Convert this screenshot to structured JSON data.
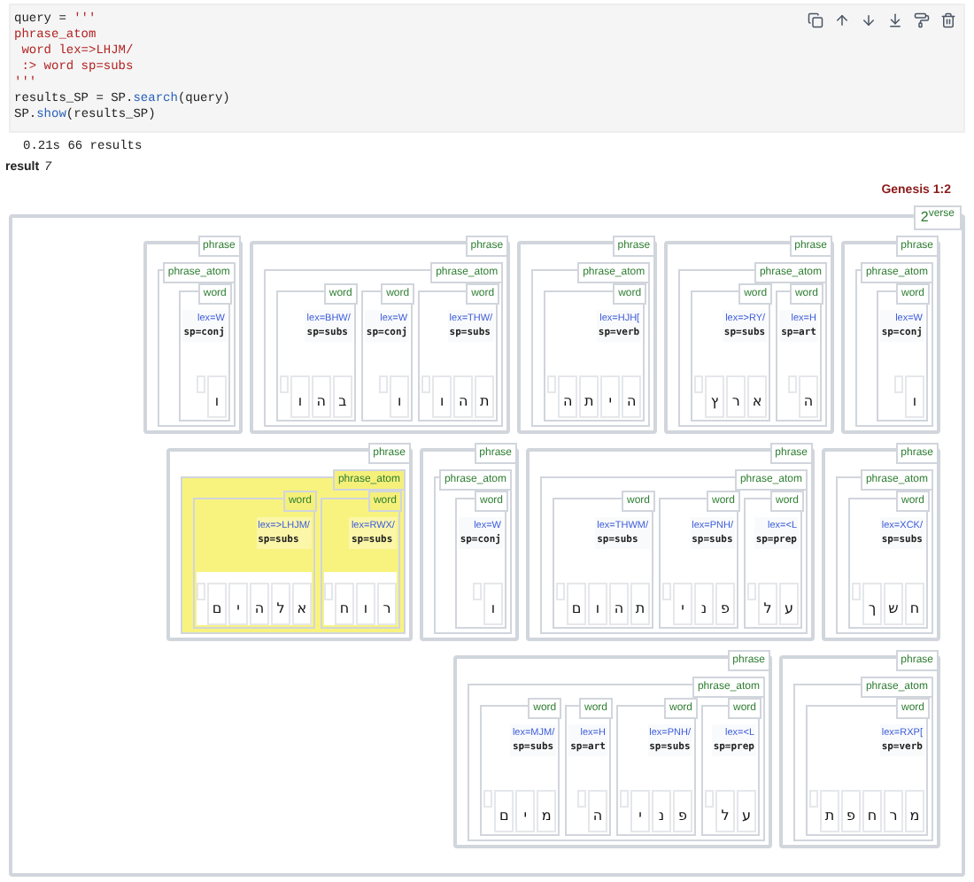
{
  "code_cell": {
    "lines": [
      [
        {
          "text": "query = ",
          "kind": "plain"
        },
        {
          "text": "'''",
          "kind": "string"
        }
      ],
      [
        {
          "text": "phrase_atom",
          "kind": "string"
        }
      ],
      [
        {
          "text": " word lex=>LHJM/",
          "kind": "string"
        }
      ],
      [
        {
          "text": " :> word sp=subs",
          "kind": "string"
        }
      ],
      [
        {
          "text": "'''",
          "kind": "string"
        }
      ],
      [
        {
          "text": "results_SP = SP.",
          "kind": "plain"
        },
        {
          "text": "search",
          "kind": "function"
        },
        {
          "text": "(query)",
          "kind": "plain"
        }
      ],
      [
        {
          "text": "SP.",
          "kind": "plain"
        },
        {
          "text": "show",
          "kind": "function"
        },
        {
          "text": "(results_SP)",
          "kind": "plain"
        }
      ]
    ]
  },
  "output": {
    "timing": "0.21s 66 results",
    "result_label": "result",
    "result_number": "7",
    "passage": "Genesis 1:2"
  },
  "verse": {
    "label": "2$^{verse}$",
    "lines": [
      {
        "phrases": [
          {
            "label": "phrase",
            "atom": {
              "label": "phrase_atom",
              "highlighted": false,
              "words": [
                {
                  "label": "word",
                  "lex": "lex=W",
                  "sp": "sp=conj",
                  "highlighted": false,
                  "letters": [
                    "ו"
                  ]
                }
              ]
            }
          },
          {
            "label": "phrase",
            "atom": {
              "label": "phrase_atom",
              "highlighted": false,
              "words": [
                {
                  "label": "word",
                  "lex": "lex=BHW/",
                  "sp": "sp=subs",
                  "highlighted": false,
                  "letters": [
                    "ב",
                    "ה",
                    "ו"
                  ]
                },
                {
                  "label": "word",
                  "lex": "lex=W",
                  "sp": "sp=conj",
                  "highlighted": false,
                  "letters": [
                    "ו"
                  ]
                },
                {
                  "label": "word",
                  "lex": "lex=THW/",
                  "sp": "sp=subs",
                  "highlighted": false,
                  "letters": [
                    "ת",
                    "ה",
                    "ו"
                  ]
                }
              ]
            }
          },
          {
            "label": "phrase",
            "atom": {
              "label": "phrase_atom",
              "highlighted": false,
              "words": [
                {
                  "label": "word",
                  "lex": "lex=HJH[",
                  "sp": "sp=verb",
                  "highlighted": false,
                  "letters": [
                    "ה",
                    "י",
                    "ת",
                    "ה"
                  ]
                }
              ]
            }
          },
          {
            "label": "phrase",
            "atom": {
              "label": "phrase_atom",
              "highlighted": false,
              "words": [
                {
                  "label": "word",
                  "lex": "lex=>RY/",
                  "sp": "sp=subs",
                  "highlighted": false,
                  "letters": [
                    "א",
                    "ר",
                    "ץ"
                  ]
                },
                {
                  "label": "word",
                  "lex": "lex=H",
                  "sp": "sp=art",
                  "highlighted": false,
                  "letters": [
                    "ה"
                  ]
                }
              ]
            }
          },
          {
            "label": "phrase",
            "atom": {
              "label": "phrase_atom",
              "highlighted": false,
              "words": [
                {
                  "label": "word",
                  "lex": "lex=W",
                  "sp": "sp=conj",
                  "highlighted": false,
                  "letters": [
                    "ו"
                  ]
                }
              ]
            }
          }
        ]
      },
      {
        "phrases": [
          {
            "label": "phrase",
            "atom": {
              "label": "phrase_atom",
              "highlighted": true,
              "words": [
                {
                  "label": "word",
                  "lex": "lex=>LHJM/",
                  "sp": "sp=subs",
                  "highlighted": true,
                  "letters": [
                    "א",
                    "ל",
                    "ה",
                    "י",
                    "ם"
                  ]
                },
                {
                  "label": "word",
                  "lex": "lex=RWX/",
                  "sp": "sp=subs",
                  "highlighted": true,
                  "letters": [
                    "ר",
                    "ו",
                    "ח"
                  ]
                }
              ]
            }
          },
          {
            "label": "phrase",
            "atom": {
              "label": "phrase_atom",
              "highlighted": false,
              "words": [
                {
                  "label": "word",
                  "lex": "lex=W",
                  "sp": "sp=conj",
                  "highlighted": false,
                  "letters": [
                    "ו"
                  ]
                }
              ]
            }
          },
          {
            "label": "phrase",
            "atom": {
              "label": "phrase_atom",
              "highlighted": false,
              "words": [
                {
                  "label": "word",
                  "lex": "lex=THWM/",
                  "sp": "sp=subs",
                  "highlighted": false,
                  "letters": [
                    "ת",
                    "ה",
                    "ו",
                    "ם"
                  ]
                },
                {
                  "label": "word",
                  "lex": "lex=PNH/",
                  "sp": "sp=subs",
                  "highlighted": false,
                  "letters": [
                    "פ",
                    "נ",
                    "י"
                  ]
                },
                {
                  "label": "word",
                  "lex": "lex=<L",
                  "sp": "sp=prep",
                  "highlighted": false,
                  "letters": [
                    "ע",
                    "ל"
                  ]
                }
              ]
            }
          },
          {
            "label": "phrase",
            "atom": {
              "label": "phrase_atom",
              "highlighted": false,
              "words": [
                {
                  "label": "word",
                  "lex": "lex=XCK/",
                  "sp": "sp=subs",
                  "highlighted": false,
                  "letters": [
                    "ח",
                    "ש",
                    "ך"
                  ]
                }
              ]
            }
          }
        ]
      },
      {
        "phrases": [
          {
            "label": "phrase",
            "atom": {
              "label": "phrase_atom",
              "highlighted": false,
              "words": [
                {
                  "label": "word",
                  "lex": "lex=MJM/",
                  "sp": "sp=subs",
                  "highlighted": false,
                  "letters": [
                    "מ",
                    "י",
                    "ם"
                  ]
                },
                {
                  "label": "word",
                  "lex": "lex=H",
                  "sp": "sp=art",
                  "highlighted": false,
                  "letters": [
                    "ה"
                  ]
                },
                {
                  "label": "word",
                  "lex": "lex=PNH/",
                  "sp": "sp=subs",
                  "highlighted": false,
                  "letters": [
                    "פ",
                    "נ",
                    "י"
                  ]
                },
                {
                  "label": "word",
                  "lex": "lex=<L",
                  "sp": "sp=prep",
                  "highlighted": false,
                  "letters": [
                    "ע",
                    "ל"
                  ]
                }
              ]
            }
          },
          {
            "label": "phrase",
            "atom": {
              "label": "phrase_atom",
              "highlighted": false,
              "words": [
                {
                  "label": "word",
                  "lex": "lex=RXP[",
                  "sp": "sp=verb",
                  "highlighted": false,
                  "letters": [
                    "מ",
                    "ר",
                    "ח",
                    "פ",
                    "ת"
                  ]
                }
              ]
            }
          }
        ]
      }
    ]
  }
}
